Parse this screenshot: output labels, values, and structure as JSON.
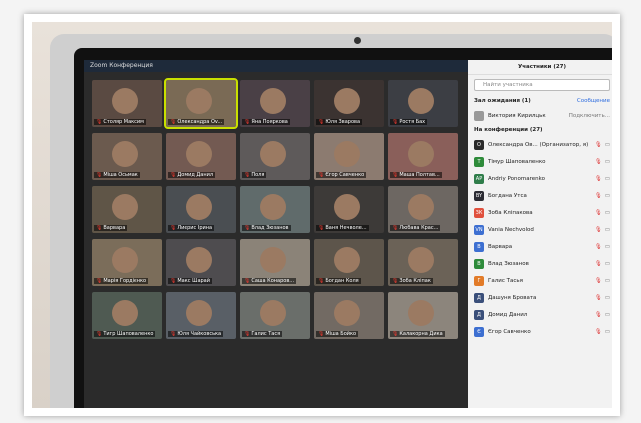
{
  "window": {
    "title": "Zoom Конференция"
  },
  "tiles": [
    {
      "label": "Столяр Максим",
      "color": "#5a4a42"
    },
    {
      "label": "Олександра Ov...",
      "color": "#7a6a55",
      "active": true
    },
    {
      "label": "Яна Пояркова",
      "color": "#4a4046"
    },
    {
      "label": "Юля Зварова",
      "color": "#3b3331"
    },
    {
      "label": "Ростя Бах",
      "color": "#3c3e44"
    },
    {
      "label": "Міша Осьмак",
      "color": "#6b5a4e"
    },
    {
      "label": "Домид Данил",
      "color": "#735a52"
    },
    {
      "label": "Поля",
      "color": "#5e5a5a"
    },
    {
      "label": "Єгор Савченко",
      "color": "#8c7b70"
    },
    {
      "label": "Маша Полтав...",
      "color": "#8a5f5a"
    },
    {
      "label": "Варвара",
      "color": "#5f5547"
    },
    {
      "label": "Лиєрис Ірина",
      "color": "#4a4e52"
    },
    {
      "label": "Влад Зюзанов",
      "color": "#606b6b"
    },
    {
      "label": "Ваня Нечволе...",
      "color": "#3d3a38"
    },
    {
      "label": "Любава Крас...",
      "color": "#6d6762"
    },
    {
      "label": "Марія Гордієнко",
      "color": "#7b6d5a"
    },
    {
      "label": "Макс Шарай",
      "color": "#4e4c4f"
    },
    {
      "label": "Саша Конаров...",
      "color": "#8b8378"
    },
    {
      "label": "Богдан Коля",
      "color": "#5d554b"
    },
    {
      "label": "Зоба Кліпак",
      "color": "#6b6257"
    },
    {
      "label": "Тигр Шаповаленко",
      "color": "#4f5a52"
    },
    {
      "label": "Юля Чайковська",
      "color": "#595f66"
    },
    {
      "label": "Галис Тася",
      "color": "#6a6e6a"
    },
    {
      "label": "Міша Бойко",
      "color": "#726a63"
    },
    {
      "label": "Калакорна Дика",
      "color": "#8c857c"
    }
  ],
  "participants": {
    "title": "Участники (27)",
    "search_placeholder": "Найти участника",
    "waiting_label": "Зал ожидания (1)",
    "admit_label": "Сообщение",
    "waiting_name": "Виктория Кирилцьк",
    "waiting_action": "Подключить...",
    "in_meeting_label": "На конференции (27)",
    "list": [
      {
        "initials": "О",
        "name": "Олександра Ов... (Организатор, я)",
        "color": "#2a2a2a"
      },
      {
        "initials": "Т",
        "name": "Тімур Шаповаленко",
        "color": "#2e8b3a"
      },
      {
        "initials": "AP",
        "name": "Andriy Ponomarenko",
        "color": "#2f7d4a"
      },
      {
        "initials": "BY",
        "name": "Богдана Утса",
        "color": "#2b2b33"
      },
      {
        "initials": "ЗК",
        "name": "Зоба Кліпакова",
        "color": "#e0503d"
      },
      {
        "initials": "VN",
        "name": "Vania Nechvolod",
        "color": "#3d6fd1"
      },
      {
        "initials": "В",
        "name": "Варвара",
        "color": "#3d6fd1"
      },
      {
        "initials": "В",
        "name": "Влад Зюзанов",
        "color": "#2e8b3a"
      },
      {
        "initials": "Г",
        "name": "Галис Тасья",
        "color": "#e27b28"
      },
      {
        "initials": "Д",
        "name": "Дашуня Бровата",
        "color": "#3a4f7a"
      },
      {
        "initials": "Д",
        "name": "Домид Данил",
        "color": "#3a4f7a"
      },
      {
        "initials": "Є",
        "name": "Єгор Савченко",
        "color": "#3d6fd1"
      }
    ]
  }
}
